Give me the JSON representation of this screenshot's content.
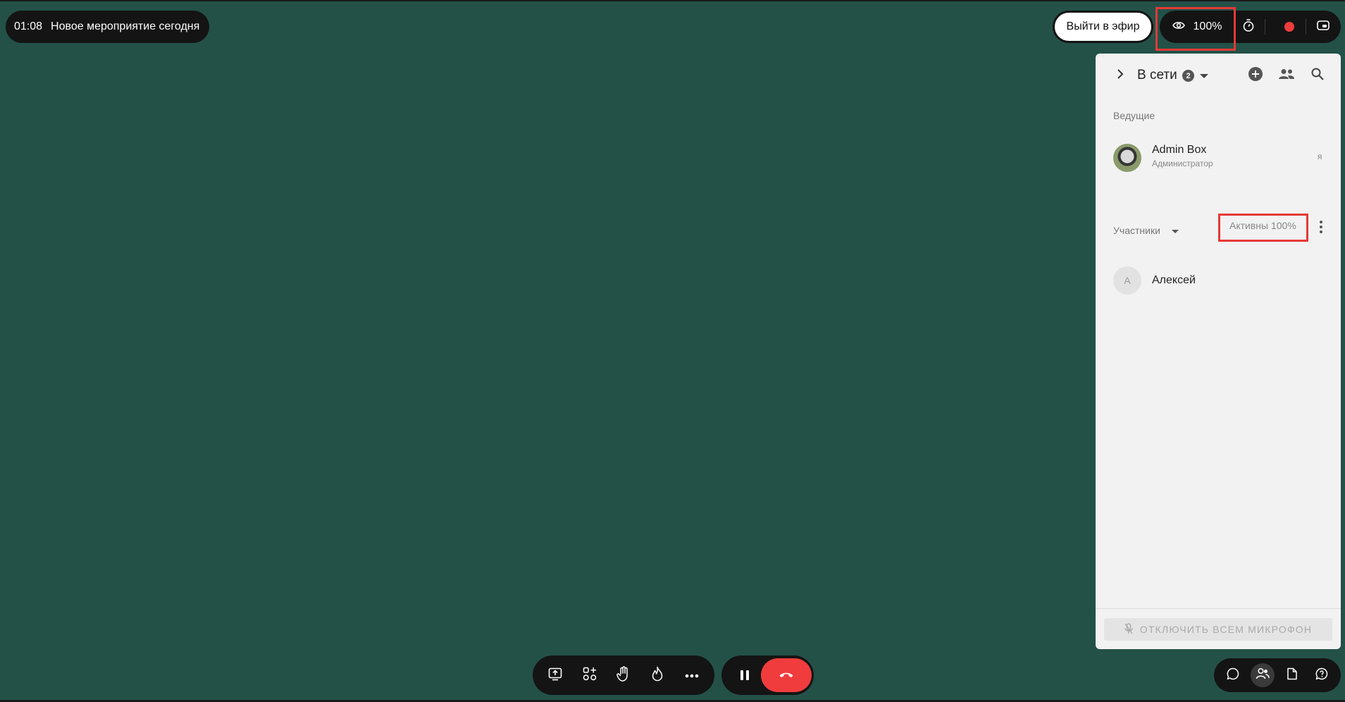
{
  "event": {
    "time": "01:08",
    "title": "Новое мероприятие сегодня"
  },
  "top": {
    "go_live_label": "Выйти в эфир",
    "views_percent": "100%"
  },
  "panel": {
    "title": "В сети",
    "online_count": "2",
    "hosts_label": "Ведущие",
    "host": {
      "name": "Admin Box",
      "role": "Администратор",
      "me_label": "я"
    },
    "participants_label": "Участники",
    "active_label": "Активны 100%",
    "participants": [
      {
        "initial": "А",
        "name": "Алексей"
      }
    ],
    "mute_all_label": "ОТКЛЮЧИТЬ ВСЕМ МИКРОФОН"
  },
  "colors": {
    "stage_bg": "#235148",
    "toolbar_bg": "#141414",
    "accent_red": "#f03c3c",
    "panel_bg": "#f2f2f2"
  },
  "icons": {
    "top_controls": [
      "eye-icon",
      "timer-icon",
      "record-icon",
      "picture-in-picture-icon"
    ],
    "panel_header": [
      "chevron-right-icon",
      "caret-down-icon",
      "add-circle-icon",
      "group-icon",
      "search-icon"
    ],
    "bottom_tools": [
      "screen-share-icon",
      "add-apps-icon",
      "raise-hand-icon",
      "flame-icon",
      "more-horizontal-icon"
    ],
    "call": [
      "pause-icon",
      "hang-up-icon"
    ],
    "right_tools": [
      "chat-icon",
      "participants-icon",
      "file-icon",
      "help-icon"
    ]
  }
}
